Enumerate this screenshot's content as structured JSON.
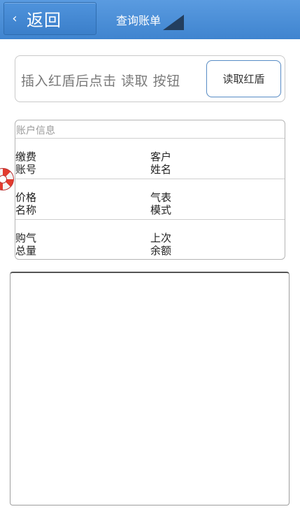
{
  "header": {
    "back_label": "返回",
    "back_icon": "chevron-left-icon",
    "title": "查询账单"
  },
  "read_section": {
    "hint": "插入红盾后点击 读取 按钮",
    "read_button_label": "读取红盾"
  },
  "account": {
    "title": "账户信息",
    "rows": [
      {
        "left": {
          "line1": "缴费",
          "line2": "账号"
        },
        "right": {
          "line1": "客户",
          "line2": "姓名"
        }
      },
      {
        "left": {
          "line1": "价格",
          "line2": "名称"
        },
        "right": {
          "line1": "气表",
          "line2": "模式"
        }
      },
      {
        "left": {
          "line1": "购气",
          "line2": "总量"
        },
        "right": {
          "line1": "上次",
          "line2": "余额"
        }
      }
    ]
  },
  "colors": {
    "header_bg": "#4a8fd6",
    "accent_border": "#5b8fc9",
    "ring_red": "#e23b2e"
  }
}
